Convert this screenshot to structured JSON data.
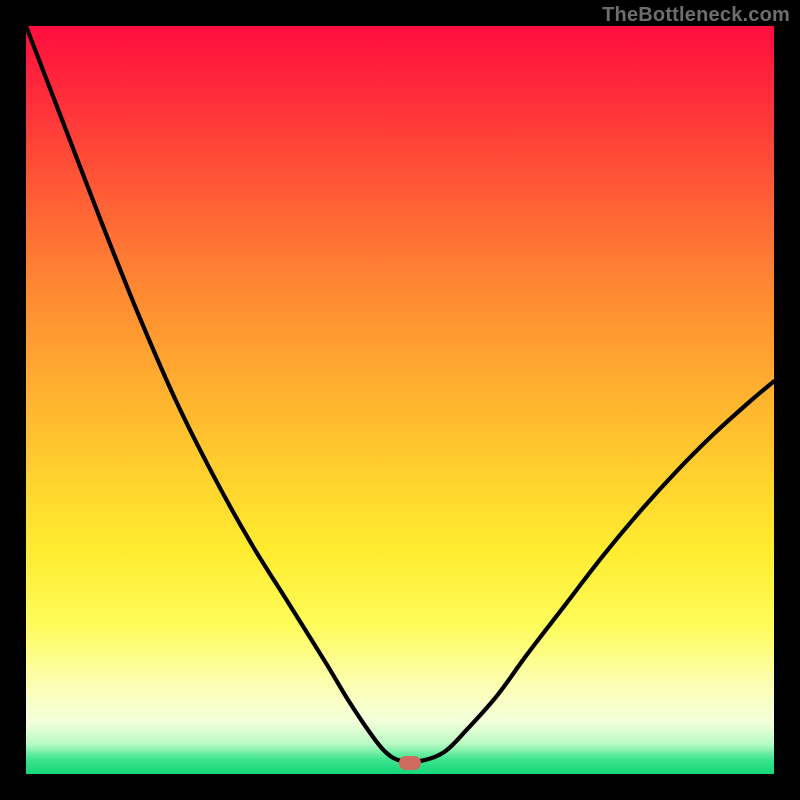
{
  "watermark": "TheBottleneck.com",
  "marker": {
    "x_frac": 0.513,
    "y_frac": 0.985
  },
  "chart_data": {
    "type": "line",
    "title": "",
    "xlabel": "",
    "ylabel": "",
    "xlim": [
      0,
      1
    ],
    "ylim": [
      0,
      1
    ],
    "series": [
      {
        "name": "bottleneck-curve",
        "x": [
          0.0,
          0.05,
          0.1,
          0.15,
          0.2,
          0.25,
          0.3,
          0.35,
          0.4,
          0.43,
          0.46,
          0.48,
          0.5,
          0.53,
          0.56,
          0.59,
          0.63,
          0.67,
          0.72,
          0.77,
          0.82,
          0.87,
          0.92,
          0.97,
          1.0
        ],
        "y": [
          1.0,
          0.87,
          0.74,
          0.615,
          0.5,
          0.4,
          0.31,
          0.23,
          0.15,
          0.1,
          0.055,
          0.03,
          0.018,
          0.018,
          0.03,
          0.06,
          0.105,
          0.16,
          0.225,
          0.29,
          0.35,
          0.405,
          0.455,
          0.5,
          0.525
        ]
      }
    ],
    "background_gradient": {
      "stops": [
        {
          "pos": 0.0,
          "color": "#ff0d3e"
        },
        {
          "pos": 0.35,
          "color": "#ff8833"
        },
        {
          "pos": 0.7,
          "color": "#ffec30"
        },
        {
          "pos": 0.93,
          "color": "#f4ffdc"
        },
        {
          "pos": 1.0,
          "color": "#15d87a"
        }
      ]
    },
    "marker": {
      "x": 0.513,
      "y": 0.015,
      "color": "#cf6a61"
    }
  }
}
